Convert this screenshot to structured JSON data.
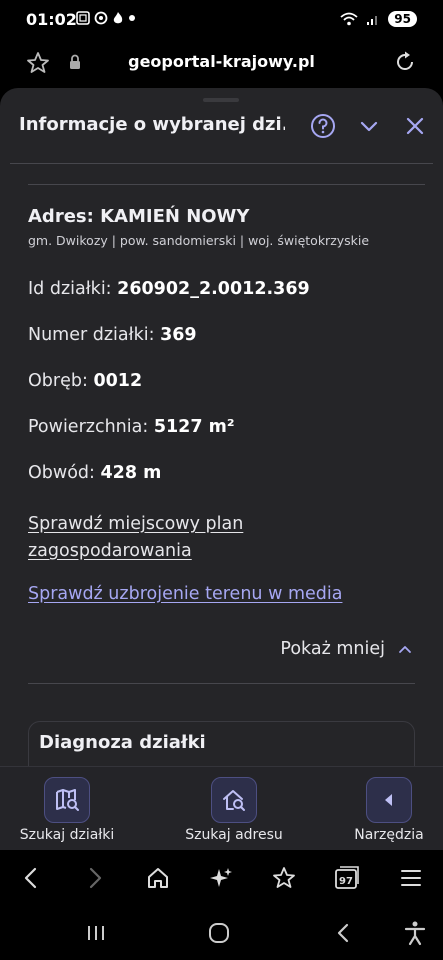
{
  "status": {
    "time": "01:02",
    "notif_icons": [
      "screenshot-icon",
      "threads-icon",
      "fire-icon",
      "dot-icon"
    ],
    "battery": "95"
  },
  "browser": {
    "url": "geoportal-krajowy.pl",
    "tab_count": "97"
  },
  "panel": {
    "title": "Informacje o wybranej dzi...",
    "address_title": "Adres: KAMIEŃ NOWY",
    "address_sub": "gm. Dwikozy | pow. sandomierski | woj. świętokrzyskie",
    "fields": [
      {
        "label": "Id działki:",
        "value": "260902_2.0012.369"
      },
      {
        "label": "Numer działki:",
        "value": "369"
      },
      {
        "label": "Obręb:",
        "value": "0012"
      },
      {
        "label": "Powierzchnia:",
        "value": "5127 m²"
      },
      {
        "label": "Obwód:",
        "value": "428 m"
      }
    ],
    "link_plan": "Sprawdź miejscowy plan zagospodarowania",
    "link_media": "Sprawdź uzbrojenie terenu w media",
    "show_less": "Pokaż mniej",
    "diagnosis_title": "Diagnoza działki"
  },
  "toolbar": {
    "search_parcel": "Szukaj działki",
    "search_address": "Szukaj adresu",
    "tools": "Narzędzia"
  },
  "colors": {
    "accent": "#a6a7f2",
    "panel_bg": "#252528"
  }
}
